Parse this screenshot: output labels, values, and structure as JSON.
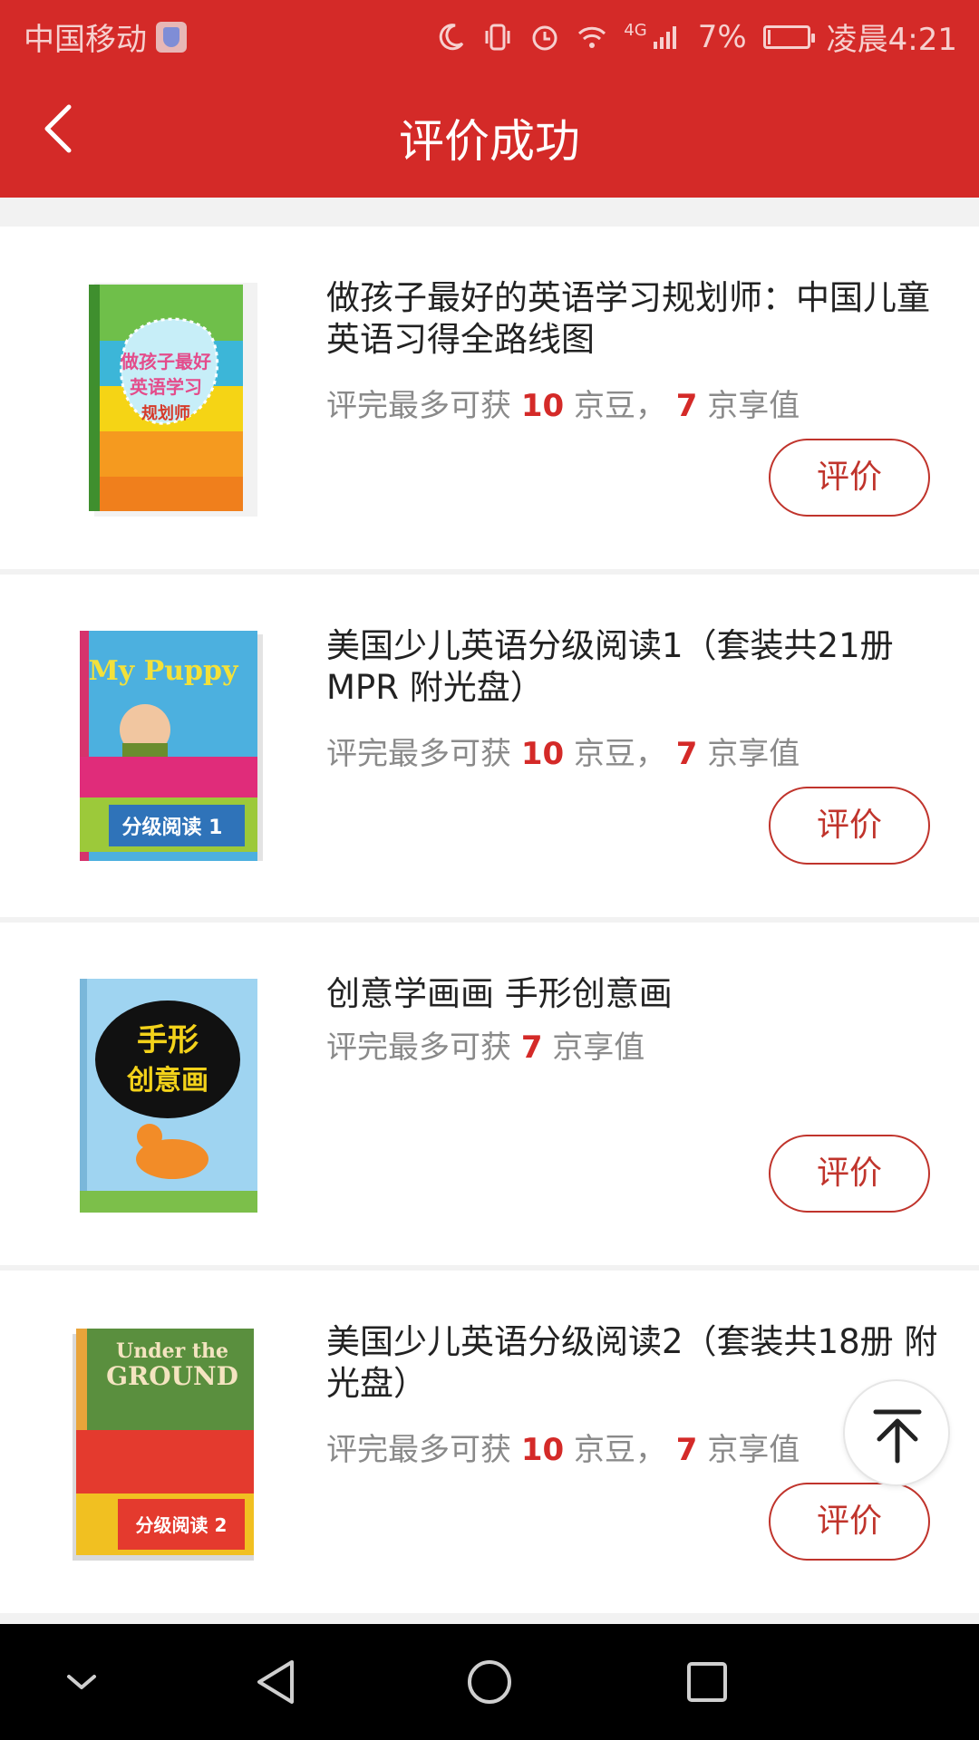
{
  "status_bar": {
    "carrier": "中国移动",
    "network": "4G",
    "battery_percent_text": "7%",
    "battery_level": 0.07,
    "time": "凌晨4:21",
    "icons": [
      "carrier-shield-icon",
      "moon-icon",
      "vibrate-icon",
      "alarm-icon",
      "wifi-icon",
      "signal-icon",
      "battery-icon"
    ]
  },
  "header": {
    "title": "评价成功",
    "back_icon": "chevron-left-icon"
  },
  "colors": {
    "brand_red": "#d42a28",
    "accent_text": "#d42a28",
    "button_border": "#c0342c"
  },
  "items": [
    {
      "title": "做孩子最好的英语学习规划师：中国儿童英语习得全路线图",
      "reward_prefix": "评完最多可获",
      "jingdou": "10",
      "jingdou_unit": "京豆，",
      "jxz": "7",
      "jxz_unit": "京享值",
      "button": "评价",
      "cover_text": "做孩子最好的英语学习规划师",
      "cover_icon": "book-cover-english-planner"
    },
    {
      "title": "美国少儿英语分级阅读1（套装共21册 MPR 附光盘）",
      "reward_prefix": "评完最多可获",
      "jingdou": "10",
      "jingdou_unit": "京豆，",
      "jxz": "7",
      "jxz_unit": "京享值",
      "button": "评价",
      "cover_text": "My Puppy",
      "cover_text_2": "分级阅读 1",
      "cover_icon": "book-cover-my-puppy"
    },
    {
      "title": "创意学画画 手形创意画",
      "reward_prefix": "评完最多可获",
      "jxz": "7",
      "jxz_unit": "京享值",
      "button": "评价",
      "cover_text": "手形创意画",
      "cover_icon": "book-cover-hand-art"
    },
    {
      "title": "美国少儿英语分级阅读2（套装共18册 附光盘）",
      "reward_prefix": "评完最多可获",
      "jingdou": "10",
      "jingdou_unit": "京豆，",
      "jxz": "7",
      "jxz_unit": "京享值",
      "button": "评价",
      "cover_text": "Under the GROUND",
      "cover_text_2": "分级阅读 2",
      "cover_icon": "book-cover-under-the-ground"
    }
  ],
  "floating": {
    "to_top_icon": "arrow-to-top-icon"
  },
  "system_nav": [
    "chevron-down-icon",
    "back-triangle-icon",
    "home-circle-icon",
    "recents-square-icon"
  ]
}
